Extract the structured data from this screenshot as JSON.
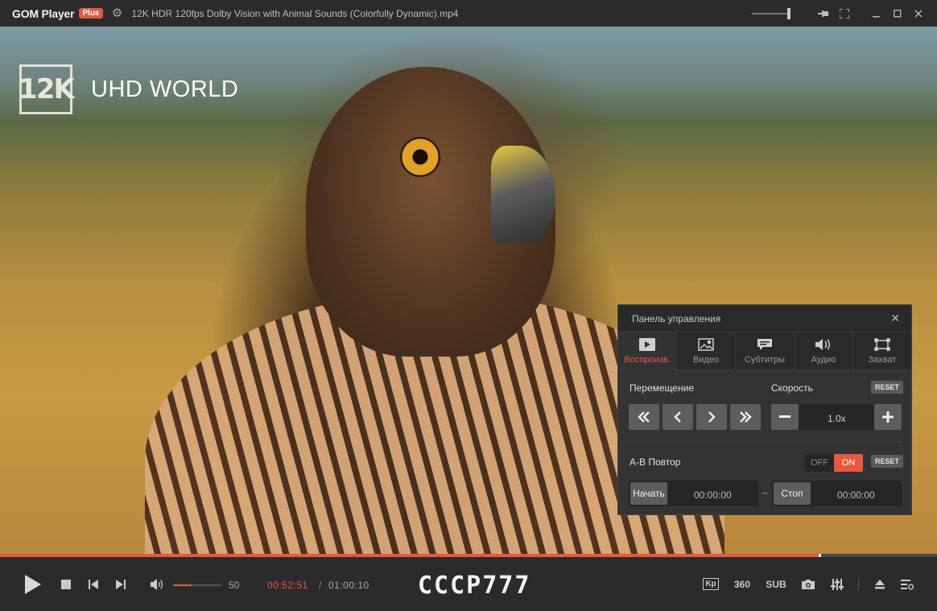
{
  "titlebar": {
    "logo": "GOM Player",
    "badge": "Plus",
    "filename": "12K HDR 120fps Dolby Vision with Animal Sounds (Colorfully Dynamic).mp4",
    "icons": {
      "settings": "gear-icon",
      "pin": "pin-icon",
      "fullscreen": "fullscreen-icon",
      "minimize": "minimize-icon",
      "maximize": "maximize-icon",
      "close": "close-icon"
    }
  },
  "video": {
    "watermark_badge": "12K",
    "watermark_text": "UHD WORLD"
  },
  "panel": {
    "title": "Панель управления",
    "tabs": [
      {
        "label": "Воспроизв.",
        "icon": "play-tab-icon",
        "active": true
      },
      {
        "label": "Видео",
        "icon": "image-icon",
        "active": false
      },
      {
        "label": "Субтитры",
        "icon": "subtitles-icon",
        "active": false
      },
      {
        "label": "Аудио",
        "icon": "speaker-icon",
        "active": false
      },
      {
        "label": "Захват",
        "icon": "capture-icon",
        "active": false
      }
    ],
    "move_label": "Перемещение",
    "speed_label": "Скорость",
    "reset_label": "RESET",
    "speed_value": "1.0x",
    "ab_label": "A-B Повтор",
    "off_label": "OFF",
    "on_label": "ON",
    "ab_enabled": true,
    "start_label": "Начать",
    "start_time": "00:00:00",
    "tilde": "~",
    "stop_label": "Стоп",
    "stop_time": "00:00:00"
  },
  "playback": {
    "progress_fraction": 0.874,
    "volume": "50",
    "volume_fraction": 0.38,
    "current_time": "00:52:51",
    "separator": "/",
    "total_time": "01:00:10",
    "overlay_caption": "СССР777",
    "right_labels": {
      "kp": "Kp",
      "vr": "360",
      "sub": "SUB"
    }
  },
  "colors": {
    "accent": "#e8583f"
  }
}
